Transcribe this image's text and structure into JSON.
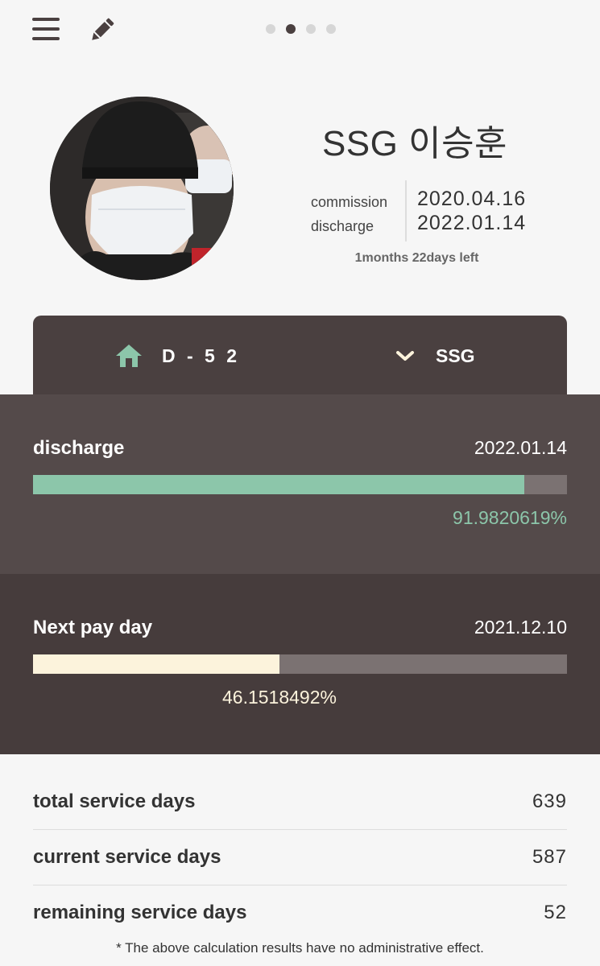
{
  "header": {
    "menu_icon": "hamburger-icon",
    "edit_icon": "pencil-icon",
    "page_indicator": {
      "count": 4,
      "active_index": 1
    }
  },
  "profile": {
    "name": "SSG 이승훈",
    "commission_label": "commission",
    "discharge_label": "discharge",
    "commission_date": "2020.04.16",
    "discharge_date": "2022.01.14",
    "time_left": "1months 22days left"
  },
  "tabs": {
    "dday_icon": "home-icon",
    "dday_label": "D - 5 2",
    "unit_icon": "chevron-down-icon",
    "unit_label": "SSG"
  },
  "discharge_progress": {
    "title": "discharge",
    "date": "2022.01.14",
    "percent_text": "91.9820619%",
    "fraction": 0.919820619,
    "color": "#8cc6aa"
  },
  "payday_progress": {
    "title": "Next pay day",
    "date": "2021.12.10",
    "percent_text": "46.1518492%",
    "fraction": 0.461518492,
    "color": "#fcf3dc"
  },
  "stats": [
    {
      "label": "total service days",
      "value": "639"
    },
    {
      "label": "current service days",
      "value": "587"
    },
    {
      "label": "remaining service days",
      "value": "52"
    }
  ],
  "footnote": "* The above calculation results have no administrative effect.",
  "colors": {
    "background": "#f6f6f6",
    "dark": "#4a4040",
    "accent_green": "#8cc6aa",
    "accent_cream": "#fcf3dc"
  }
}
